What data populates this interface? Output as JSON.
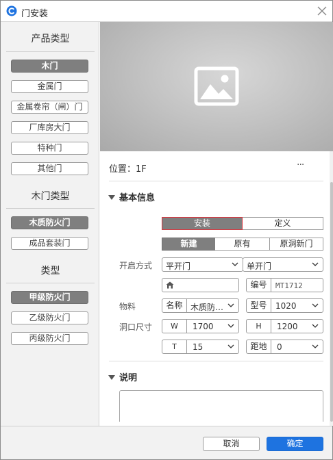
{
  "window": {
    "title": "门安装",
    "accent_color": "#1e73e0"
  },
  "left_panel": {
    "product_types": {
      "title": "产品类型",
      "items": [
        "木门",
        "金属门",
        "金属卷帘（闸）门",
        "厂库房大门",
        "特种门",
        "其他门"
      ],
      "selected": "木门"
    },
    "wood_door_types": {
      "title": "木门类型",
      "items": [
        "木质防火门",
        "成品套装门"
      ],
      "selected": "木质防火门"
    },
    "types": {
      "title": "类型",
      "items": [
        "甲级防火门",
        "乙级防火门",
        "丙级防火门"
      ],
      "selected": "甲级防火门"
    }
  },
  "preview": {
    "icon": "image-placeholder-icon"
  },
  "position": {
    "label": "位置：",
    "value": "1F",
    "more": "···"
  },
  "basic_info": {
    "title": "基本信息",
    "mode_tabs": [
      "安装",
      "定义"
    ],
    "mode_selected": "安装",
    "source_tabs": [
      "新建",
      "原有",
      "原洞新门"
    ],
    "source_selected": "新建",
    "open_mode": {
      "label": "开启方式",
      "type1": "平开门",
      "type2": "单开门"
    },
    "room_field": {
      "icon": "home-icon",
      "value": ""
    },
    "code": {
      "label": "编号",
      "value": "MT1712"
    },
    "material": {
      "label": "物料",
      "name_label": "名称",
      "name_value": "木质防…",
      "model_label": "型号",
      "model_value": "1020"
    },
    "opening": {
      "label": "洞口尺寸",
      "w_label": "W",
      "w_value": "1700",
      "h_label": "H",
      "h_value": "1200",
      "t_label": "T",
      "t_value": "15",
      "sill_label": "距地",
      "sill_value": "0"
    }
  },
  "description": {
    "title": "说明",
    "value": ""
  },
  "footer": {
    "cancel": "取消",
    "ok": "确定"
  }
}
